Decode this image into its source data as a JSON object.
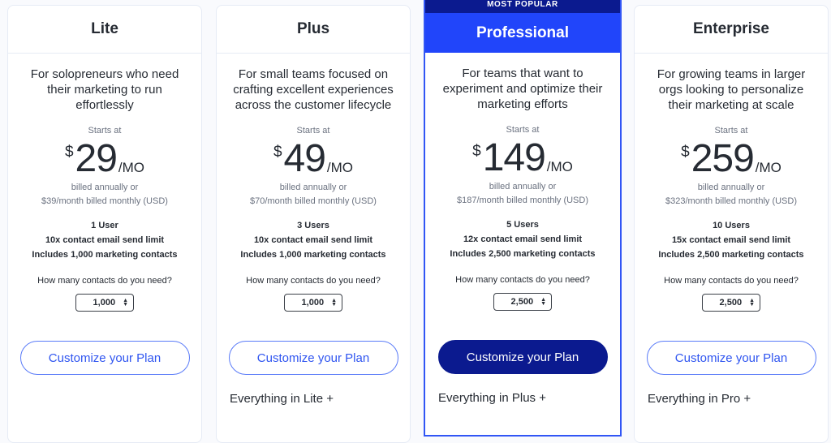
{
  "plans": [
    {
      "name": "Lite",
      "featured": false,
      "description": "For solopreneurs who need their marketing to run effortlessly",
      "starts_at_label": "Starts at",
      "currency_symbol": "$",
      "price": "29",
      "period": "/MO",
      "billing_line1": "billed annually or",
      "billing_line2": "$39/month billed monthly (USD)",
      "features": [
        "1 User",
        "10x contact email send limit",
        "Includes 1,000 marketing contacts"
      ],
      "contacts_question": "How many contacts do you need?",
      "contacts_value": "1,000",
      "cta_label": "Customize your Plan",
      "everything_in": ""
    },
    {
      "name": "Plus",
      "featured": false,
      "description": "For small teams focused on crafting excellent experiences across the customer lifecycle",
      "starts_at_label": "Starts at",
      "currency_symbol": "$",
      "price": "49",
      "period": "/MO",
      "billing_line1": "billed annually or",
      "billing_line2": "$70/month billed monthly (USD)",
      "features": [
        "3 Users",
        "10x contact email send limit",
        "Includes 1,000 marketing contacts"
      ],
      "contacts_question": "How many contacts do you need?",
      "contacts_value": "1,000",
      "cta_label": "Customize your Plan",
      "everything_in": "Everything in Lite +"
    },
    {
      "name": "Professional",
      "featured": true,
      "badge": "MOST POPULAR",
      "description": "For teams that want to experiment and optimize their marketing efforts",
      "starts_at_label": "Starts at",
      "currency_symbol": "$",
      "price": "149",
      "period": "/MO",
      "billing_line1": "billed annually or",
      "billing_line2": "$187/month billed monthly (USD)",
      "features": [
        "5 Users",
        "12x contact email send limit",
        "Includes 2,500 marketing contacts"
      ],
      "contacts_question": "How many contacts do you need?",
      "contacts_value": "2,500",
      "cta_label": "Customize your Plan",
      "everything_in": "Everything in Plus +"
    },
    {
      "name": "Enterprise",
      "featured": false,
      "description": "For growing teams in larger orgs looking to personalize their marketing at scale",
      "starts_at_label": "Starts at",
      "currency_symbol": "$",
      "price": "259",
      "period": "/MO",
      "billing_line1": "billed annually or",
      "billing_line2": "$323/month billed monthly (USD)",
      "features": [
        "10 Users",
        "15x contact email send limit",
        "Includes 2,500 marketing contacts"
      ],
      "contacts_question": "How many contacts do you need?",
      "contacts_value": "2,500",
      "cta_label": "Customize your Plan",
      "everything_in": "Everything in Pro +"
    }
  ],
  "colors": {
    "accent": "#2145fa",
    "accent_dark": "#0b1a8f",
    "outline_button": "#5a7bf8",
    "background": "#f9fafd"
  },
  "icons": {
    "stepper": "up-down-arrows-icon"
  }
}
